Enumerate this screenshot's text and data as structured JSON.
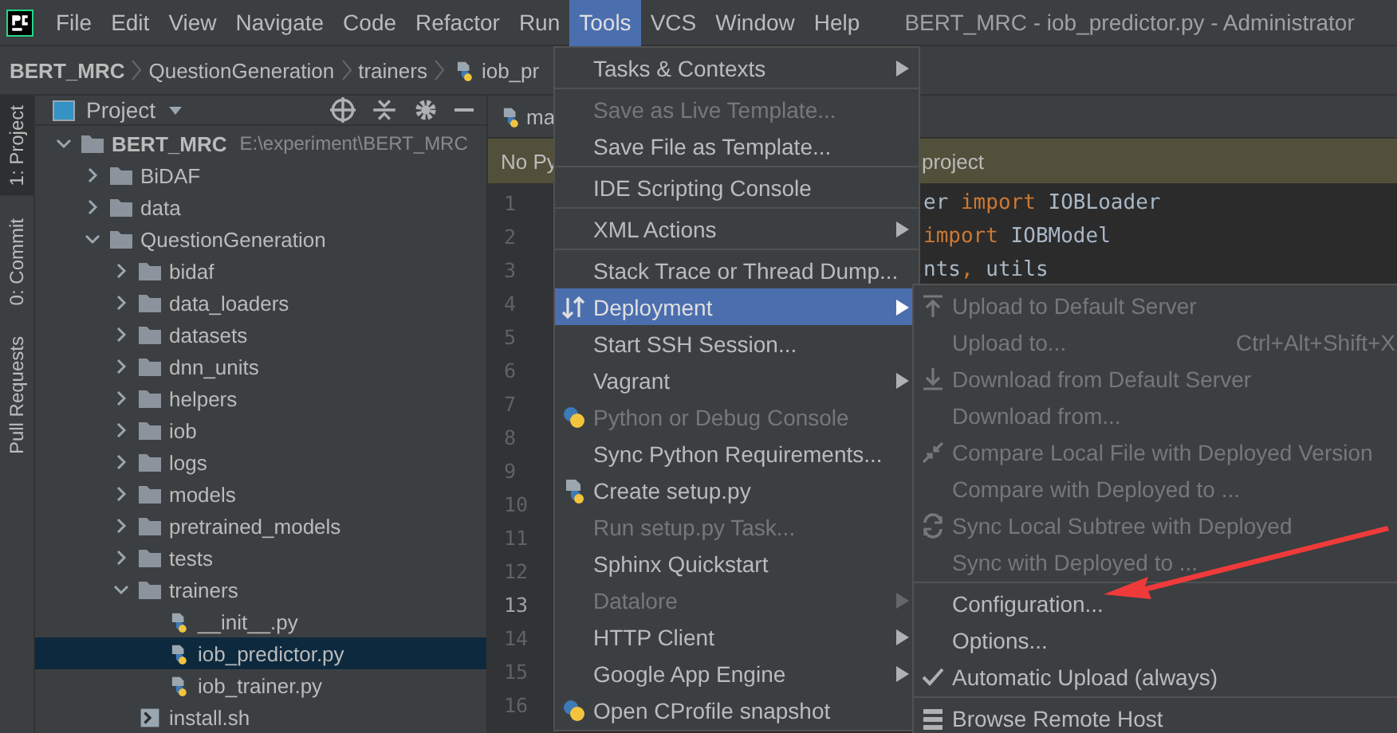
{
  "menubar": {
    "items": [
      {
        "label": "File",
        "selected": false
      },
      {
        "label": "Edit",
        "selected": false
      },
      {
        "label": "View",
        "selected": false
      },
      {
        "label": "Navigate",
        "selected": false
      },
      {
        "label": "Code",
        "selected": false
      },
      {
        "label": "Refactor",
        "selected": false
      },
      {
        "label": "Run",
        "selected": false
      },
      {
        "label": "Tools",
        "selected": true
      },
      {
        "label": "VCS",
        "selected": false
      },
      {
        "label": "Window",
        "selected": false
      },
      {
        "label": "Help",
        "selected": false
      }
    ],
    "title": "BERT_MRC - iob_predictor.py - Administrator"
  },
  "breadcrumbs": [
    {
      "label": "BERT_MRC",
      "kind": "root"
    },
    {
      "label": "QuestionGeneration",
      "kind": "folder"
    },
    {
      "label": "trainers",
      "kind": "folder"
    },
    {
      "label": "iob_pr",
      "kind": "python"
    }
  ],
  "tool_strip": [
    {
      "label": "1: Project",
      "selected": true
    },
    {
      "label": "0: Commit",
      "selected": false
    },
    {
      "label": "Pull Requests",
      "selected": false
    }
  ],
  "project_panel": {
    "title": "Project",
    "tree": [
      {
        "label": "BERT_MRC",
        "path": "E:\\experiment\\BERT_MRC",
        "kind": "folder",
        "expanded": true,
        "selected": false,
        "children": [
          {
            "label": "BiDAF",
            "kind": "folder",
            "expanded": false,
            "selected": false
          },
          {
            "label": "data",
            "kind": "folder",
            "expanded": false,
            "selected": false
          },
          {
            "label": "QuestionGeneration",
            "kind": "folder",
            "expanded": true,
            "selected": false,
            "children": [
              {
                "label": "bidaf",
                "kind": "folder",
                "expanded": false,
                "selected": false
              },
              {
                "label": "data_loaders",
                "kind": "folder",
                "expanded": false,
                "selected": false
              },
              {
                "label": "datasets",
                "kind": "folder",
                "expanded": false,
                "selected": false
              },
              {
                "label": "dnn_units",
                "kind": "folder",
                "expanded": false,
                "selected": false
              },
              {
                "label": "helpers",
                "kind": "folder",
                "expanded": false,
                "selected": false
              },
              {
                "label": "iob",
                "kind": "folder",
                "expanded": false,
                "selected": false
              },
              {
                "label": "logs",
                "kind": "folder",
                "expanded": false,
                "selected": false
              },
              {
                "label": "models",
                "kind": "folder",
                "expanded": false,
                "selected": false
              },
              {
                "label": "pretrained_models",
                "kind": "folder",
                "expanded": false,
                "selected": false
              },
              {
                "label": "tests",
                "kind": "folder",
                "expanded": false,
                "selected": false
              },
              {
                "label": "trainers",
                "kind": "folder",
                "expanded": true,
                "selected": false,
                "children": [
                  {
                    "label": "__init__.py",
                    "kind": "python",
                    "selected": false
                  },
                  {
                    "label": "iob_predictor.py",
                    "kind": "python",
                    "selected": true
                  },
                  {
                    "label": "iob_trainer.py",
                    "kind": "python",
                    "selected": false
                  }
                ]
              },
              {
                "label": "install.sh",
                "kind": "shell",
                "selected": false
              }
            ]
          }
        ]
      }
    ]
  },
  "editor": {
    "tab": "ma",
    "banner": {
      "left": "No Py",
      "right": "project"
    },
    "line_numbers": [
      {
        "label": "1",
        "current": false
      },
      {
        "label": "2",
        "current": false
      },
      {
        "label": "3",
        "current": false
      },
      {
        "label": "4",
        "current": false
      },
      {
        "label": "5",
        "current": false
      },
      {
        "label": "6",
        "current": false
      },
      {
        "label": "7",
        "current": false
      },
      {
        "label": "8",
        "current": false
      },
      {
        "label": "9",
        "current": false
      },
      {
        "label": "10",
        "current": false
      },
      {
        "label": "11",
        "current": false
      },
      {
        "label": "12",
        "current": false
      },
      {
        "label": "13",
        "current": true
      },
      {
        "label": "14",
        "current": false
      },
      {
        "label": "15",
        "current": false
      },
      {
        "label": "16",
        "current": false
      }
    ],
    "code": [
      [
        {
          "text": "er ",
          "kind": "plain"
        },
        {
          "text": "import",
          "kind": "keyword"
        },
        {
          "text": " IOBLoader",
          "kind": "plain"
        }
      ],
      [
        {
          "text": "import",
          "kind": "keyword"
        },
        {
          "text": " IOBModel",
          "kind": "plain"
        }
      ],
      [
        {
          "text": "nts",
          "kind": "plain"
        },
        {
          "text": ",",
          "kind": "keyword"
        },
        {
          "text": " utils",
          "kind": "plain"
        }
      ]
    ]
  },
  "tools_menu": [
    {
      "label": "Tasks & Contexts",
      "submenu": true,
      "disabled": false,
      "selected": false
    },
    {
      "kind": "separator"
    },
    {
      "label": "Save as Live Template...",
      "disabled": true,
      "selected": false
    },
    {
      "label": "Save File as Template...",
      "disabled": false,
      "selected": false
    },
    {
      "kind": "separator"
    },
    {
      "label": "IDE Scripting Console",
      "disabled": false,
      "selected": false
    },
    {
      "kind": "separator"
    },
    {
      "label": "XML Actions",
      "submenu": true,
      "disabled": false,
      "selected": false
    },
    {
      "kind": "separator"
    },
    {
      "label": "Stack Trace or Thread Dump...",
      "disabled": false,
      "selected": false
    },
    {
      "label": "Deployment",
      "kind": "updown",
      "submenu": true,
      "disabled": false,
      "selected": true
    },
    {
      "label": "Start SSH Session...",
      "disabled": false,
      "selected": false
    },
    {
      "label": "Vagrant",
      "submenu": true,
      "disabled": false,
      "selected": false
    },
    {
      "label": "Python or Debug Console",
      "kind": "python",
      "disabled": true,
      "selected": false
    },
    {
      "label": "Sync Python Requirements...",
      "disabled": false,
      "selected": false
    },
    {
      "label": "Create setup.py",
      "kind": "pyfile",
      "disabled": false,
      "selected": false
    },
    {
      "label": "Run setup.py Task...",
      "disabled": true,
      "selected": false
    },
    {
      "label": "Sphinx Quickstart",
      "disabled": false,
      "selected": false
    },
    {
      "label": "Datalore",
      "submenu": true,
      "disabled": true,
      "selected": false
    },
    {
      "label": "HTTP Client",
      "submenu": true,
      "disabled": false,
      "selected": false
    },
    {
      "label": "Google App Engine",
      "submenu": true,
      "disabled": false,
      "selected": false
    },
    {
      "label": "Open CProfile snapshot",
      "kind": "python",
      "disabled": false,
      "selected": false
    }
  ],
  "deployment_submenu": [
    {
      "label": "Upload to Default Server",
      "kind": "upload",
      "disabled": true,
      "selected": false
    },
    {
      "label": "Upload to...",
      "shortcut": "Ctrl+Alt+Shift+X",
      "disabled": true,
      "selected": false
    },
    {
      "label": "Download from Default Server",
      "kind": "download",
      "disabled": true,
      "selected": false
    },
    {
      "label": "Download from...",
      "disabled": true,
      "selected": false
    },
    {
      "label": "Compare Local File with Deployed Version",
      "kind": "compare",
      "disabled": true,
      "selected": false
    },
    {
      "label": "Compare with Deployed to ...",
      "disabled": true,
      "selected": false
    },
    {
      "label": "Sync Local Subtree with Deployed",
      "kind": "sync",
      "disabled": true,
      "selected": false
    },
    {
      "label": "Sync with Deployed to ...",
      "disabled": true,
      "selected": false
    },
    {
      "kind": "separator"
    },
    {
      "label": "Configuration...",
      "disabled": false,
      "selected": false
    },
    {
      "label": "Options...",
      "disabled": false,
      "selected": false
    },
    {
      "label": "Automatic Upload (always)",
      "checked": true,
      "disabled": false,
      "selected": false
    },
    {
      "kind": "separator"
    },
    {
      "label": "Browse Remote Host",
      "kind": "list",
      "disabled": false,
      "selected": false
    }
  ]
}
